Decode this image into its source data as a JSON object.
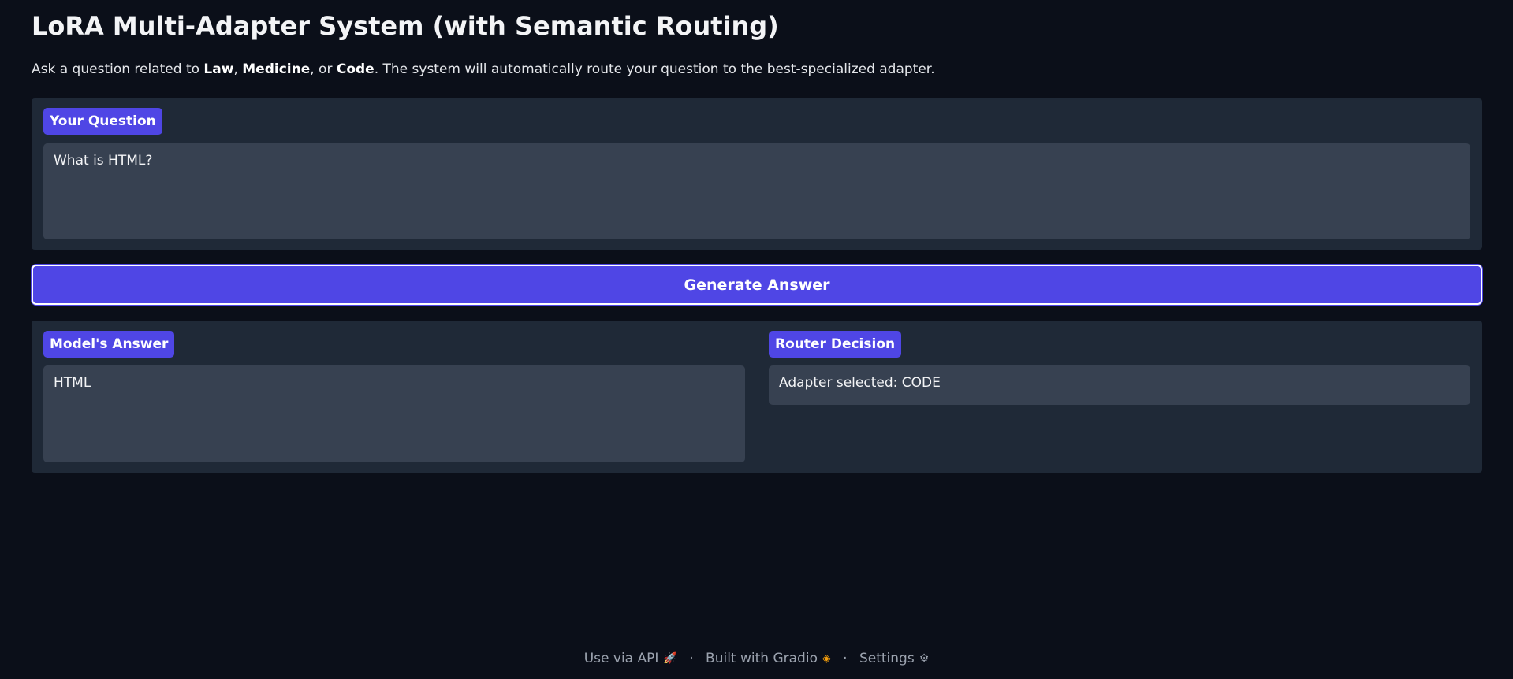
{
  "header": {
    "title": "LoRA Multi-Adapter System (with Semantic Routing)",
    "intro_prefix": "Ask a question related to ",
    "domain_law": "Law",
    "sep1": ", ",
    "domain_medicine": "Medicine",
    "sep2": ", or ",
    "domain_code": "Code",
    "intro_suffix": ". The system will automatically route your question to the best-specialized adapter."
  },
  "question": {
    "label": "Your Question",
    "value": "What is HTML?"
  },
  "generate_button": {
    "label": "Generate Answer"
  },
  "answer": {
    "label": "Model's Answer",
    "value": "HTML"
  },
  "router": {
    "label": "Router Decision",
    "value": "Adapter selected: CODE"
  },
  "footer": {
    "api_label": "Use via API",
    "api_icon": "🚀",
    "separator": "·",
    "built_label": "Built with Gradio",
    "gradio_icon": "◈",
    "settings_label": "Settings",
    "settings_icon": "⚙"
  },
  "colors": {
    "background": "#0b0f19",
    "panel": "#1f2937",
    "input": "#374151",
    "accent": "#4f46e5"
  }
}
